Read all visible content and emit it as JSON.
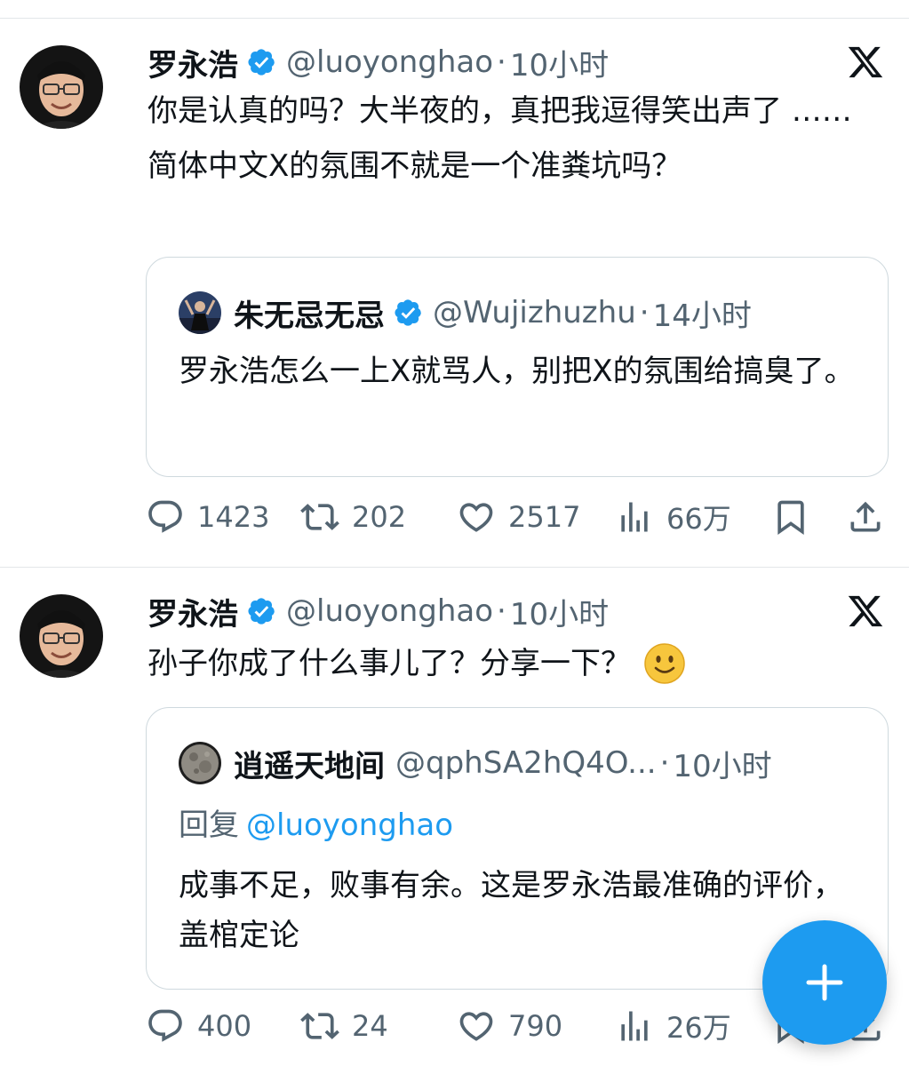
{
  "colors": {
    "accent": "#1d9bf0",
    "text": "#0f1419",
    "secondary": "#536471",
    "border": "#cfd9de"
  },
  "icons": [
    "verified-badge-icon",
    "x-logo-icon",
    "reply-icon",
    "retweet-icon",
    "like-icon",
    "views-icon",
    "bookmark-icon",
    "share-icon",
    "compose-plus-icon",
    "smile-emoji"
  ],
  "tweets": [
    {
      "author": {
        "name": "罗永浩",
        "handle": "@luoyonghao",
        "time": "10小时"
      },
      "text": "你是认真的吗？大半夜的，真把我逗得笑出声了 …… 简体中文X的氛围不就是一个准粪坑吗？",
      "quote": {
        "author": {
          "name": "朱无忌无忌",
          "handle": "@Wujizhuzhu",
          "time": "14小时"
        },
        "text": "罗永浩怎么一上X就骂人，别把X的氛围给搞臭了。"
      },
      "stats": {
        "replies": "1423",
        "retweets": "202",
        "likes": "2517",
        "views": "66万"
      }
    },
    {
      "author": {
        "name": "罗永浩",
        "handle": "@luoyonghao",
        "time": "10小时"
      },
      "text": "孙子你成了什么事儿了？分享一下？",
      "quote": {
        "author": {
          "name": "逍遥天地间",
          "handle": "@qphSA2hQ4O...",
          "time": "10小时"
        },
        "reply_prefix": "回复",
        "reply_to": "@luoyonghao",
        "text": "成事不足，败事有余。这是罗永浩最准确的评价，盖棺定论"
      },
      "stats": {
        "replies": "400",
        "retweets": "24",
        "likes": "790",
        "views": "26万"
      }
    }
  ]
}
